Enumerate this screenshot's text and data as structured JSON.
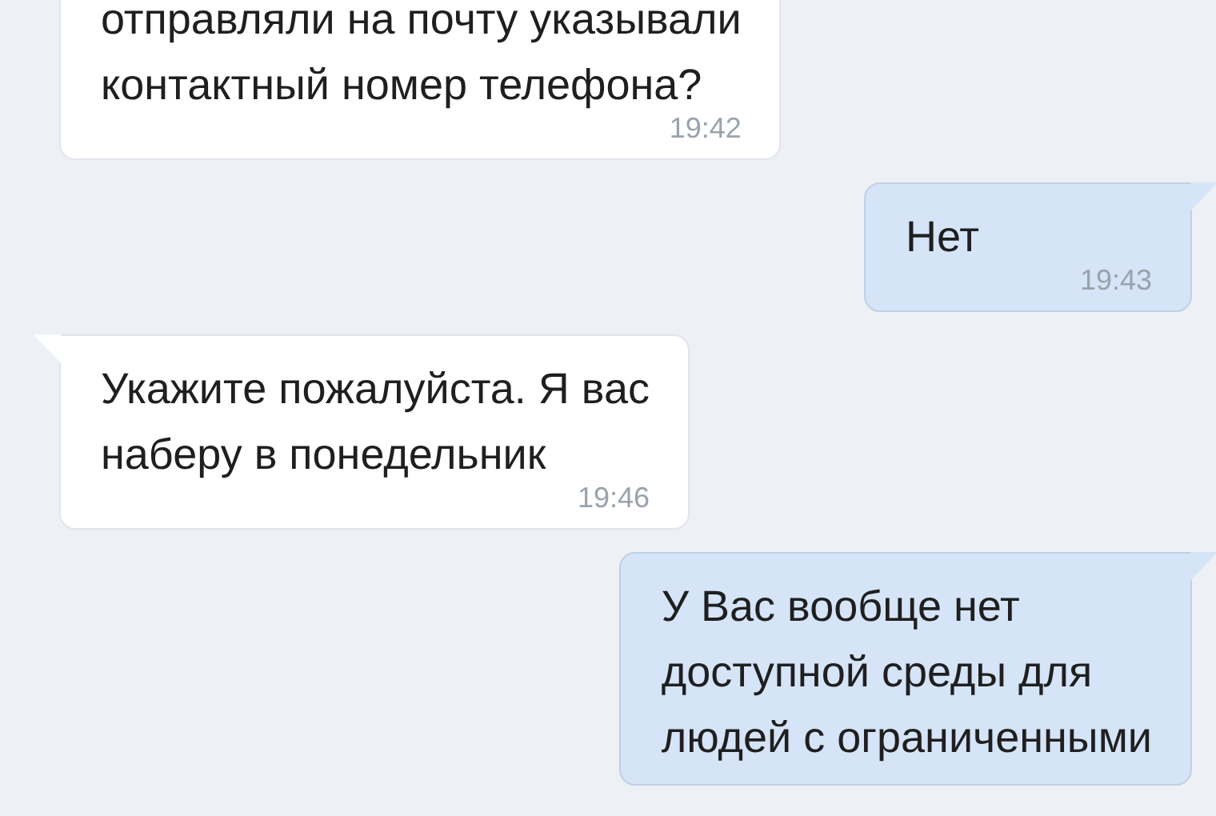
{
  "messages": [
    {
      "kind": "incoming",
      "text": "отправляли на почту указывали\nконтактный номер телефона?",
      "time": "19:42",
      "cut_top": true
    },
    {
      "kind": "outgoing",
      "text": "Нет",
      "time": "19:43"
    },
    {
      "kind": "incoming",
      "text": "Укажите пожалуйста. Я вас\nнаберу в понедельник",
      "time": "19:46"
    },
    {
      "kind": "outgoing",
      "text": "У Вас вообще нет\nдоступной среды для\nлюдей с ограниченными"
    }
  ]
}
